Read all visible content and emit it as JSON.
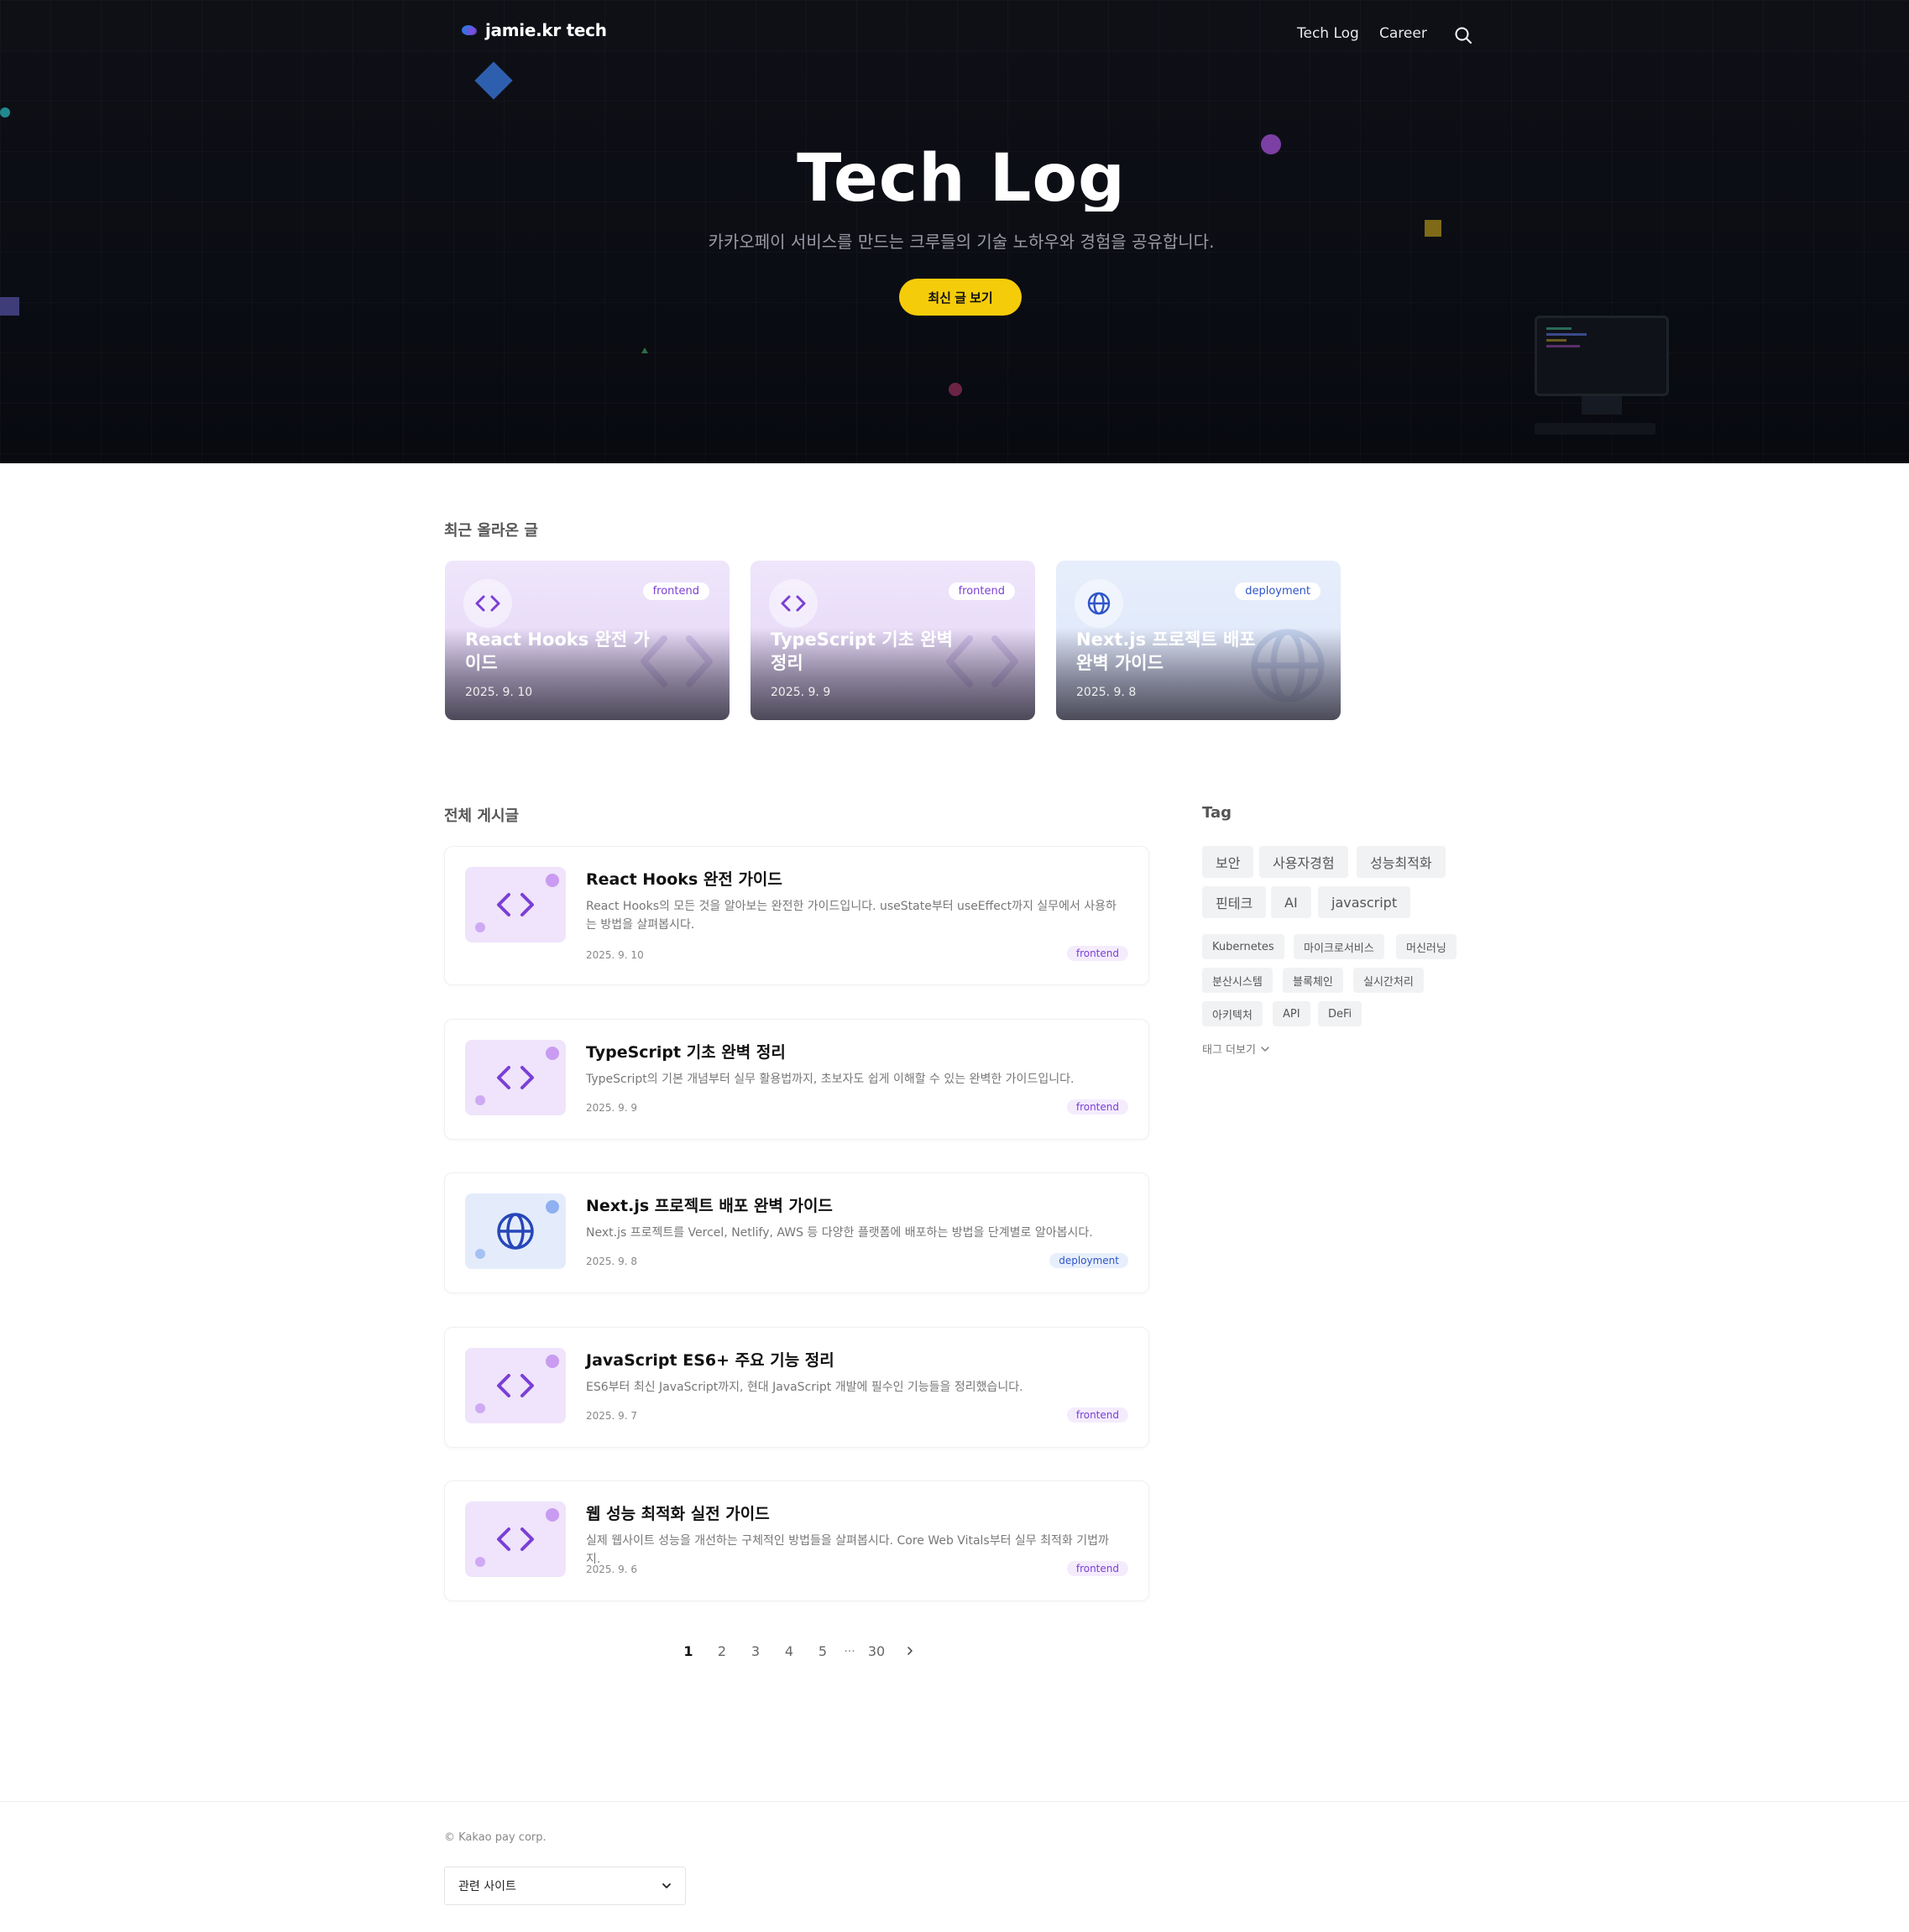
{
  "nav": {
    "logo_text": "jamie.kr tech",
    "links": [
      "Tech Log",
      "Career"
    ]
  },
  "hero": {
    "title": "Tech Log",
    "subtitle": "카카오페이 서비스를 만드는 크루들의 기술 노하우와 경험을 공유합니다.",
    "cta": "최신 글 보기"
  },
  "recent": {
    "section_title": "최근 올라온 글",
    "cards": [
      {
        "title": "React Hooks 완전 가이드",
        "date": "2025. 9. 10",
        "tag": "frontend",
        "icon": "code-icon"
      },
      {
        "title": "TypeScript 기초 완벽 정리",
        "date": "2025. 9. 9",
        "tag": "frontend",
        "icon": "code-icon"
      },
      {
        "title": "Next.js 프로젝트 배포 완벽 가이드",
        "date": "2025. 9. 8",
        "tag": "deployment",
        "icon": "globe-icon"
      }
    ]
  },
  "posts": {
    "section_title": "전체 게시글",
    "items": [
      {
        "title": "React Hooks 완전 가이드",
        "desc": "React Hooks의 모든 것을 알아보는 완전한 가이드입니다. useState부터 useEffect까지 실무에서 사용하는 방법을 살펴봅시다.",
        "date": "2025. 9. 10",
        "tag": "frontend",
        "icon": "code-icon"
      },
      {
        "title": "TypeScript 기초 완벽 정리",
        "desc": "TypeScript의 기본 개념부터 실무 활용법까지, 초보자도 쉽게 이해할 수 있는 완벽한 가이드입니다.",
        "date": "2025. 9. 9",
        "tag": "frontend",
        "icon": "code-icon"
      },
      {
        "title": "Next.js 프로젝트 배포 완벽 가이드",
        "desc": "Next.js 프로젝트를 Vercel, Netlify, AWS 등 다양한 플랫폼에 배포하는 방법을 단계별로 알아봅시다.",
        "date": "2025. 9. 8",
        "tag": "deployment",
        "icon": "globe-icon"
      },
      {
        "title": "JavaScript ES6+ 주요 기능 정리",
        "desc": "ES6부터 최신 JavaScript까지, 현대 JavaScript 개발에 필수인 기능들을 정리했습니다.",
        "date": "2025. 9. 7",
        "tag": "frontend",
        "icon": "code-icon"
      },
      {
        "title": "웹 성능 최적화 실전 가이드",
        "desc": "실제 웹사이트 성능을 개선하는 구체적인 방법들을 살펴봅시다. Core Web Vitals부터 실무 최적화 기법까지.",
        "date": "2025. 9. 6",
        "tag": "frontend",
        "icon": "code-icon"
      }
    ]
  },
  "pagination": {
    "pages": [
      "1",
      "2",
      "3",
      "4",
      "5"
    ],
    "ellipsis": "···",
    "last": "30",
    "current": "1"
  },
  "tags": {
    "section_title": "Tag",
    "primary": [
      "보안",
      "사용자경험",
      "성능최적화",
      "핀테크",
      "AI",
      "javascript"
    ],
    "secondary": [
      "Kubernetes",
      "마이크로서비스",
      "머신러닝",
      "분산시스템",
      "블록체인",
      "실시간처리",
      "아키텍처",
      "API",
      "DeFi"
    ],
    "more_label": "태그 더보기"
  },
  "footer": {
    "copyright": "© Kakao pay corp.",
    "related_label": "관련 사이트"
  },
  "colors": {
    "accent_yellow": "#f5cc0a",
    "frontend_tag": "#7b3fd6",
    "deployment_tag": "#2f55c8"
  }
}
